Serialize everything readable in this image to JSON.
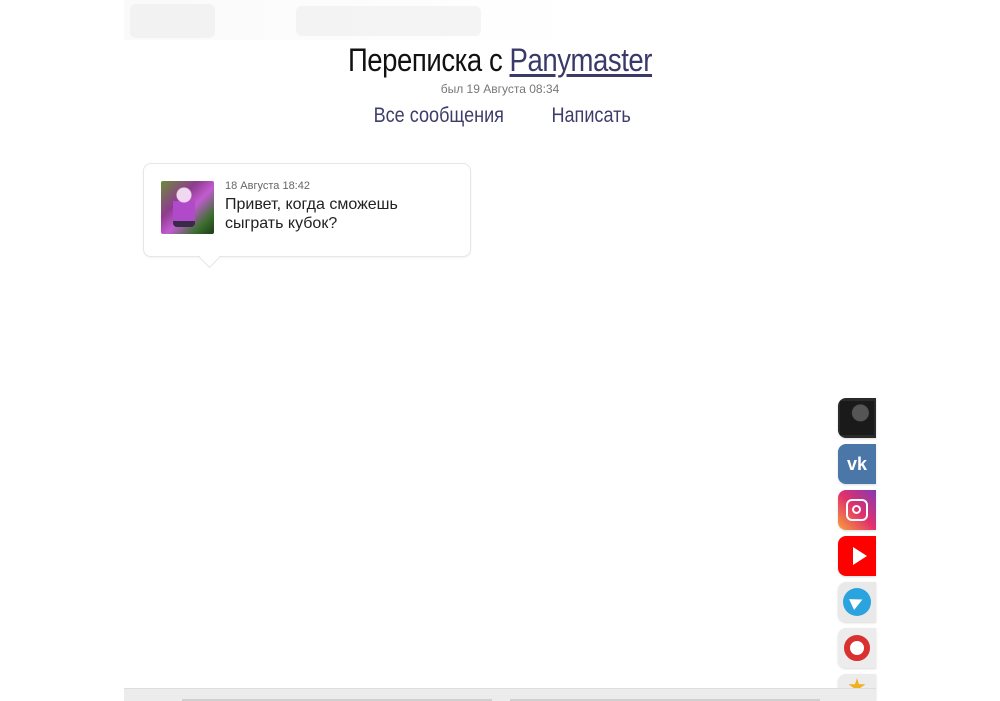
{
  "header": {
    "title_prefix": "Переписка с ",
    "username": "Panymaster",
    "last_seen": "был 19 Августа 08:34"
  },
  "nav": {
    "all_messages": "Все сообщения",
    "write": "Написать"
  },
  "messages": [
    {
      "time": "18 Августа 18:42",
      "text": "Привет, когда сможешь сыграть кубок?"
    }
  ],
  "social": {
    "vk_label": "vk",
    "icons": [
      "user-avatar-icon",
      "vk-icon",
      "instagram-icon",
      "youtube-icon",
      "telegram-icon",
      "help-lifebuoy-icon",
      "star-icon"
    ],
    "colors": {
      "vk": "#4a76a8",
      "youtube": "#ff0000",
      "telegram": "#2aa3df",
      "help": "#d93030",
      "star": "#f2b01e"
    }
  },
  "colors": {
    "link": "#3a3a6a",
    "nav_link": "#3d3d6b"
  }
}
